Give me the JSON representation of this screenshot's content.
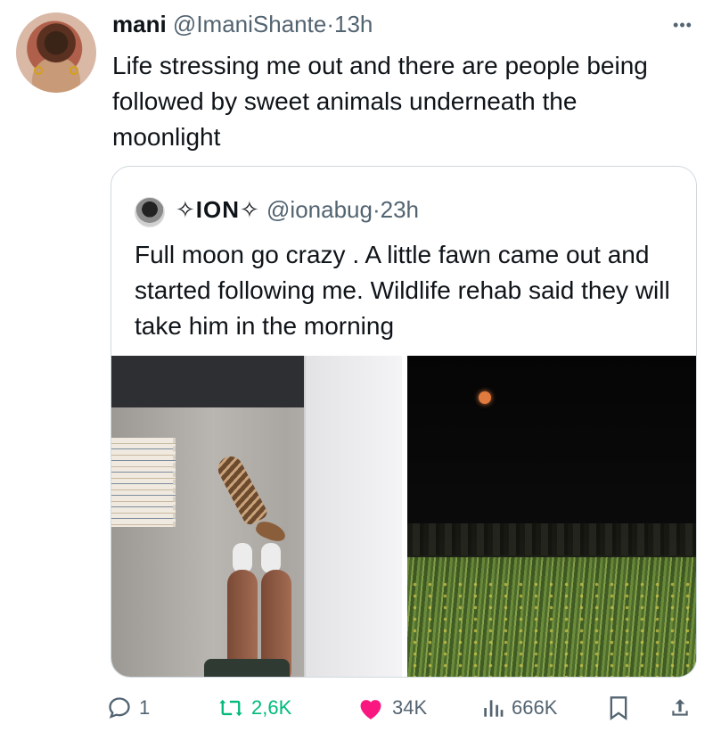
{
  "tweet": {
    "author_name": "mani",
    "author_handle": "@ImaniShante",
    "separator": "·",
    "time": "13h",
    "text": "Life stressing me out and there are people being followed by sweet animals underneath the moonlight"
  },
  "quoted_tweet": {
    "author_name": "✧ION✧",
    "author_handle": "@ionabug",
    "separator": "·",
    "time": "23h",
    "text": "Full moon go crazy . A little fawn came out and started following me. Wildlife rehab said they will take him in the morning",
    "media": [
      {
        "icon": "photo-fawn-following"
      },
      {
        "icon": "photo-full-moon-field"
      }
    ]
  },
  "actions": {
    "reply_count": "1",
    "retweet_count": "2,6K",
    "like_count": "34K",
    "views_count": "666K"
  },
  "colors": {
    "text_primary": "#0f1419",
    "text_secondary": "#536471",
    "retweet_green": "#00ba7c",
    "like_pink": "#f91880",
    "border": "#cfd9de"
  }
}
